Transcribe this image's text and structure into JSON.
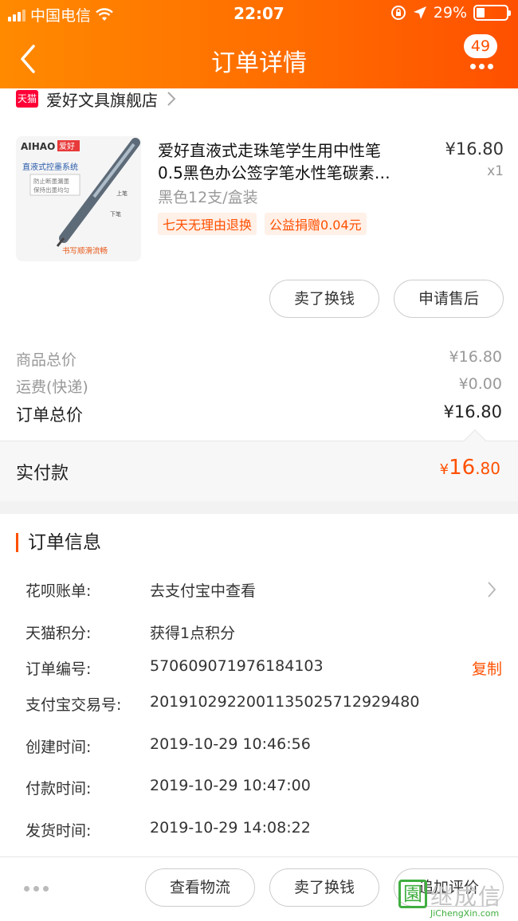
{
  "status_bar": {
    "carrier": "中国电信",
    "time": "22:07",
    "battery": "29%",
    "battery_level": 0.29
  },
  "navbar": {
    "title": "订单详情",
    "message_badge": "49"
  },
  "store": {
    "logo_text": "天猫",
    "name": "爱好文具旗舰店"
  },
  "product": {
    "title_line1": "爱好直液式走珠笔学生用中性笔",
    "title_line2": "0.5黑色办公签字笔水性笔碳素…",
    "price": "¥16.80",
    "quantity": "x1",
    "sku": "黑色12支/盒装",
    "tags": [
      "七天无理由退换",
      "公益捐赠0.04元"
    ],
    "image": {
      "brand": "AIHAO",
      "brand_cn": "爱好",
      "subtitle": "直液式控墨系统",
      "note_line1": "防止断墨漏墨",
      "note_line2": "保持出墨均匀",
      "arrow_up": "上笔",
      "arrow_down": "下笔",
      "caption": "书写顺滑流畅"
    }
  },
  "item_actions": {
    "sell": "卖了换钱",
    "after_sale": "申请售后"
  },
  "fees": {
    "goods_label": "商品总价",
    "goods_value": "¥16.80",
    "shipping_label": "运费(快递)",
    "shipping_value": "¥0.00",
    "total_label": "订单总价",
    "total_value": "¥16.80"
  },
  "paid": {
    "label": "实付款",
    "currency": "¥",
    "integer": "16",
    "decimal": ".80"
  },
  "order_info": {
    "title": "订单信息",
    "rows": [
      {
        "label": "花呗账单:",
        "value": "去支付宝中查看"
      },
      {
        "label": "天猫积分:",
        "value": "获得1点积分"
      },
      {
        "label": "订单编号:",
        "value": "570609071976184103",
        "action": "复制"
      },
      {
        "label": "支付宝交易号:",
        "value": "2019102922001135025712929480"
      },
      {
        "label": "创建时间:",
        "value": "2019-10-29 10:46:56"
      },
      {
        "label": "付款时间:",
        "value": "2019-10-29 10:47:00"
      },
      {
        "label": "发货时间:",
        "value": "2019-10-29 14:08:22"
      }
    ]
  },
  "bottom_bar": {
    "logistics": "查看物流",
    "sell": "卖了换钱",
    "review": "追加评价"
  },
  "watermark": {
    "cn": "继成信",
    "en": "JiChengXin.com",
    "box": "園"
  },
  "colors": {
    "accent": "#ff5000",
    "header_start": "#ff8a00"
  }
}
